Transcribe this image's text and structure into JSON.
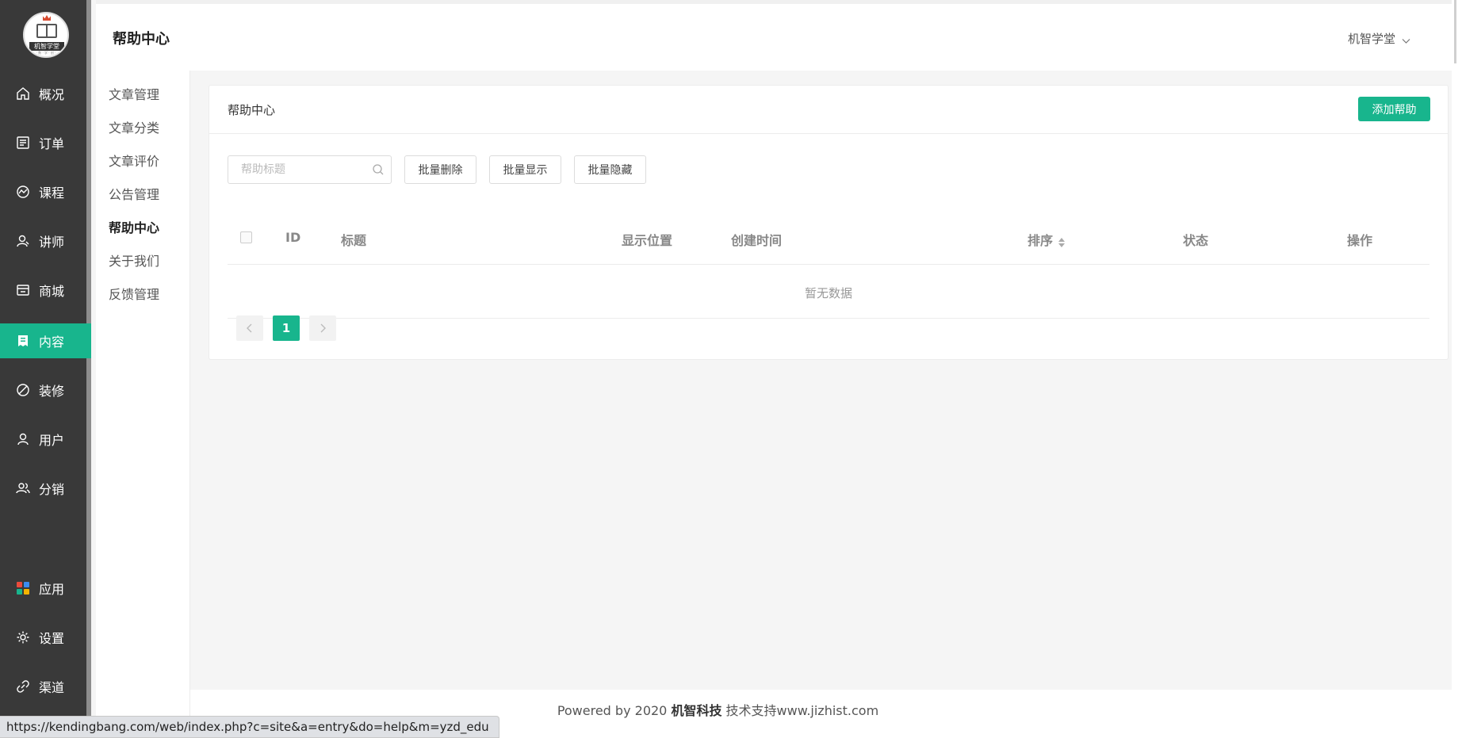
{
  "brand": {
    "logo_text": "机智学堂",
    "logo_tagline": "· 数 · 学 · 创 ·"
  },
  "sidebar": {
    "items": [
      {
        "label": "概况",
        "icon": "home-icon"
      },
      {
        "label": "订单",
        "icon": "order-list-icon"
      },
      {
        "label": "课程",
        "icon": "course-icon"
      },
      {
        "label": "讲师",
        "icon": "teacher-icon"
      },
      {
        "label": "商城",
        "icon": "store-icon"
      },
      {
        "label": "内容",
        "icon": "content-icon",
        "active": true
      },
      {
        "label": "装修",
        "icon": "decor-icon"
      },
      {
        "label": "用户",
        "icon": "user-icon"
      },
      {
        "label": "分销",
        "icon": "distribution-icon"
      }
    ],
    "bottom_items": [
      {
        "label": "应用",
        "icon": "apps-icon"
      },
      {
        "label": "设置",
        "icon": "settings-icon"
      },
      {
        "label": "渠道",
        "icon": "channel-icon"
      }
    ]
  },
  "subnav": {
    "items": [
      "文章管理",
      "文章分类",
      "文章评价",
      "公告管理",
      "帮助中心",
      "关于我们",
      "反馈管理"
    ],
    "active_index": 4
  },
  "header": {
    "title": "帮助中心",
    "user_name": "机智学堂"
  },
  "card": {
    "title": "帮助中心",
    "add_button": "添加帮助",
    "search_placeholder": "帮助标题",
    "batch_delete": "批量删除",
    "batch_show": "批量显示",
    "batch_hide": "批量隐藏"
  },
  "table": {
    "columns": [
      "ID",
      "标题",
      "显示位置",
      "创建时间",
      "排序",
      "状态",
      "操作"
    ],
    "empty_text": "暂无数据"
  },
  "pagination": {
    "current_page": "1"
  },
  "footer": {
    "prefix": "Powered by 2020 ",
    "company": "机智科技",
    "suffix": " 技术支持www.jizhist.com"
  },
  "status_bar": {
    "url": "https://kendingbang.com/web/index.php?c=site&a=entry&do=help&m=yzd_edu"
  },
  "colors": {
    "accent": "#18b58d",
    "sidebar_bg": "#393939"
  }
}
